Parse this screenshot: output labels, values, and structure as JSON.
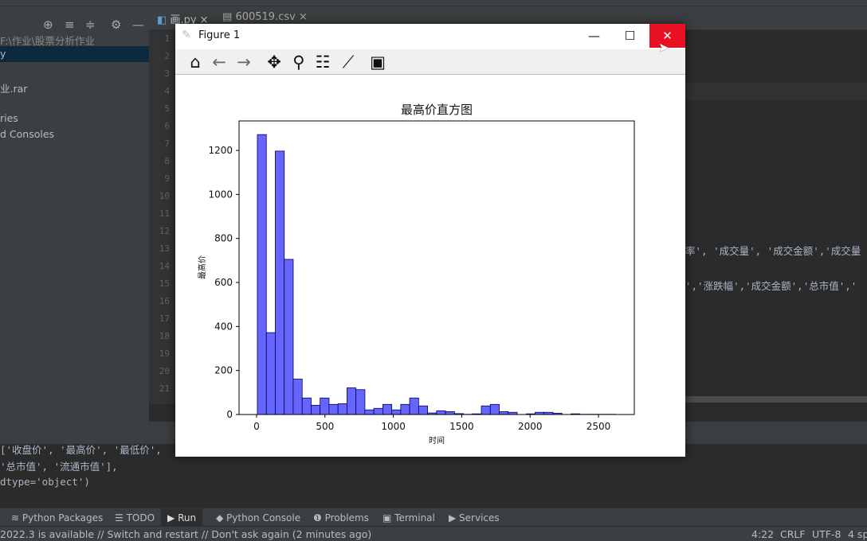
{
  "project": {
    "path": "F:\\作业\\股票分析作业",
    "items": [
      "y",
      "业.rar",
      "ries",
      "d Consoles"
    ]
  },
  "tabs": [
    {
      "label": "画.py"
    },
    {
      "label": "600519.csv"
    }
  ],
  "editor": {
    "line_numbers": [
      "1",
      "2",
      "3",
      "4",
      "5",
      "6",
      "7",
      "8",
      "9",
      "10",
      "11",
      "12",
      "13",
      "14",
      "15",
      "16",
      "17",
      "18",
      "19",
      "20",
      "21"
    ],
    "line13": "率', '成交量', '成交金额','成交量",
    "line15": "','涨跌幅','成交金额','总市值','"
  },
  "run_output": [
    "['收盘价', '最高价', '最低价',",
    "'总市值', '流通市值'],",
    "dtype='object')"
  ],
  "bottom_tabs": [
    "Python Packages",
    "TODO",
    "Run",
    "Python Console",
    "Problems",
    "Terminal",
    "Services"
  ],
  "status": {
    "message": "2022.3 is available // Switch and restart // Don't ask again (2 minutes ago)",
    "position": "4:22",
    "line_sep": "CRLF",
    "encoding": "UTF-8",
    "indent": "4 sp"
  },
  "figure": {
    "title": "Figure 1",
    "toolbar": [
      "home-icon",
      "back-icon",
      "forward-icon",
      "pan-icon",
      "zoom-icon",
      "configure-subplots-icon",
      "edit-axis-icon",
      "save-icon"
    ]
  },
  "chart_data": {
    "type": "bar",
    "title": "最高价直方图",
    "xlabel": "时间",
    "ylabel": "最高价",
    "color": "#6666ff",
    "edgecolor": "#00005a",
    "bin_start": 6,
    "bin_width": 65.5,
    "values": [
      1272,
      372,
      1197,
      705,
      161,
      75,
      42,
      75,
      46,
      49,
      121,
      113,
      21,
      28,
      46,
      21,
      46,
      75,
      39,
      7,
      17,
      13,
      4,
      1,
      3,
      39,
      46,
      13,
      10,
      0,
      3,
      10,
      10,
      6,
      0,
      3,
      1,
      1,
      1,
      1
    ],
    "xlim": [
      -128,
      2762
    ],
    "ylim": [
      0,
      1334
    ],
    "xticks": [
      0,
      500,
      1000,
      1500,
      2000,
      2500
    ],
    "yticks": [
      0,
      200,
      400,
      600,
      800,
      1000,
      1200
    ],
    "grid": false
  }
}
